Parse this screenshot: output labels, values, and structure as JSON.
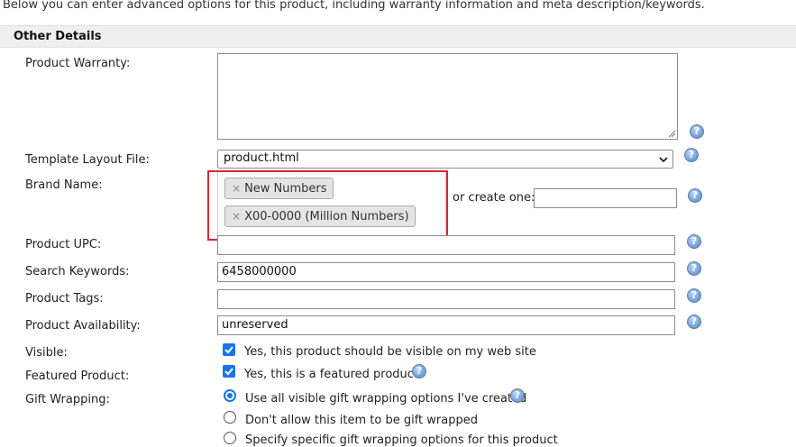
{
  "intro_text": "Below you can enter advanced options for this product, including warranty information and meta description/keywords.",
  "section_title": "Other Details",
  "labels": {
    "warranty": "Product Warranty:",
    "template": "Template Layout File:",
    "brand": "Brand Name:",
    "upc": "Product UPC:",
    "keywords": "Search Keywords:",
    "tags": "Product Tags:",
    "availability": "Product Availability:",
    "visible": "Visible:",
    "featured": "Featured Product:",
    "gift": "Gift Wrapping:"
  },
  "fields": {
    "warranty": "",
    "template": "product.html",
    "upc": "",
    "keywords": "6458000000",
    "tags": "",
    "availability": "unreserved",
    "create_brand": ""
  },
  "brand_tags": [
    "New Numbers",
    "X00-0000 (Million Numbers)"
  ],
  "tag_remove_glyph": "×",
  "create_one_label": "or create one:",
  "help_glyph": "?",
  "visible_text": "Yes, this product should be visible on my web site",
  "featured_text": "Yes, this is a featured product",
  "gift_options": [
    "Use all visible gift wrapping options I've created",
    "Don't allow this item to be gift wrapped",
    "Specify specific gift wrapping options for this product"
  ],
  "colors": {
    "accent": "#1a73e8",
    "highlight": "#d9282f",
    "section_bar": "#efefef"
  }
}
